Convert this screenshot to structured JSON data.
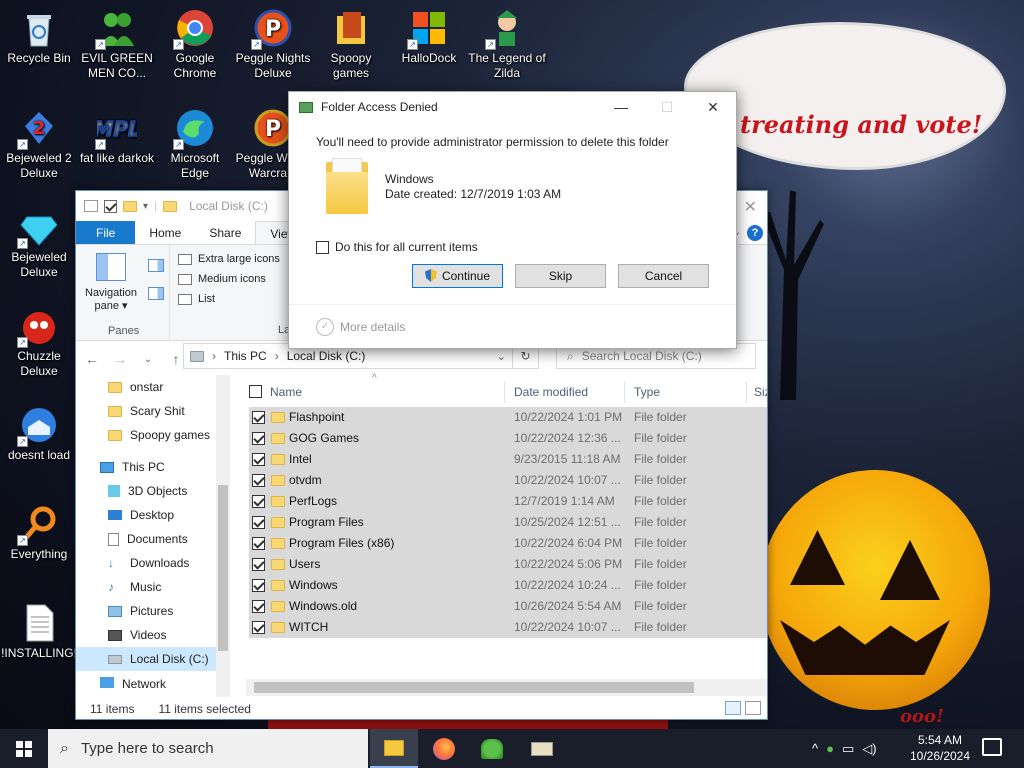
{
  "desktop": {
    "icons": [
      {
        "label": "Recycle Bin",
        "icon": "recycle-bin-icon"
      },
      {
        "label": "Bejeweled 2 Deluxe",
        "icon": "bejeweled2-icon"
      },
      {
        "label": "Bejeweled Deluxe",
        "icon": "bejeweled-icon"
      },
      {
        "label": "Chuzzle Deluxe",
        "icon": "chuzzle-icon"
      },
      {
        "label": "doesnt load",
        "icon": "thunderbird-icon"
      },
      {
        "label": "Everything",
        "icon": "everything-search-icon"
      },
      {
        "label": "!INSTALLING!",
        "icon": "text-file-icon"
      },
      {
        "label": "EVIL GREEN MEN CO...",
        "icon": "green-men-icon"
      },
      {
        "label": "fat like darkok",
        "icon": "mpl-icon"
      },
      {
        "label": "Google Chrome",
        "icon": "chrome-icon"
      },
      {
        "label": "Microsoft Edge",
        "icon": "edge-icon"
      },
      {
        "label": "Peggle Nights Deluxe",
        "icon": "peggle-nights-icon"
      },
      {
        "label": "Peggle W... of Warcra...",
        "icon": "peggle-wow-icon"
      },
      {
        "label": "Spoopy games",
        "icon": "folder-icon"
      },
      {
        "label": "HalloDock",
        "icon": "windows-logo-icon"
      },
      {
        "label": "The Legend of Zilda",
        "icon": "zilda-icon"
      }
    ],
    "wallpaper_text": {
      "line3": "treating and vote!",
      "signature": "ooo!"
    }
  },
  "explorer": {
    "title": "Local Disk (C:)",
    "tabs": [
      "File",
      "Home",
      "Share",
      "View"
    ],
    "ribbon": {
      "nav_pane_label": "Navigation pane",
      "panes_group": "Panes",
      "layout_group": "La",
      "layout_items": [
        "Extra large icons",
        "Medium icons",
        "List"
      ]
    },
    "address": {
      "segments": [
        "This PC",
        "Local Disk (C:)"
      ],
      "search_placeholder": "Search Local Disk (C:)"
    },
    "nav_items": [
      {
        "label": "onstar",
        "icon": "folder-icon"
      },
      {
        "label": "Scary Shit",
        "icon": "folder-icon"
      },
      {
        "label": "Spoopy games",
        "icon": "folder-icon"
      },
      {
        "label": "This PC",
        "icon": "computer-icon"
      },
      {
        "label": "3D Objects",
        "icon": "3d-objects-icon"
      },
      {
        "label": "Desktop",
        "icon": "desktop-icon"
      },
      {
        "label": "Documents",
        "icon": "documents-icon"
      },
      {
        "label": "Downloads",
        "icon": "downloads-icon"
      },
      {
        "label": "Music",
        "icon": "music-icon"
      },
      {
        "label": "Pictures",
        "icon": "pictures-icon"
      },
      {
        "label": "Videos",
        "icon": "videos-icon"
      },
      {
        "label": "Local Disk (C:)",
        "icon": "drive-icon",
        "selected": true
      },
      {
        "label": "Network",
        "icon": "network-icon"
      }
    ],
    "columns": [
      "Name",
      "Date modified",
      "Type",
      "Siz"
    ],
    "files": [
      {
        "name": "Flashpoint",
        "date": "10/22/2024 1:01 PM",
        "type": "File folder"
      },
      {
        "name": "GOG Games",
        "date": "10/22/2024 12:36 ...",
        "type": "File folder"
      },
      {
        "name": "Intel",
        "date": "9/23/2015 11:18 AM",
        "type": "File folder"
      },
      {
        "name": "otvdm",
        "date": "10/22/2024 10:07 ...",
        "type": "File folder"
      },
      {
        "name": "PerfLogs",
        "date": "12/7/2019 1:14 AM",
        "type": "File folder"
      },
      {
        "name": "Program Files",
        "date": "10/25/2024 12:51 ...",
        "type": "File folder"
      },
      {
        "name": "Program Files (x86)",
        "date": "10/22/2024 6:04 PM",
        "type": "File folder"
      },
      {
        "name": "Users",
        "date": "10/22/2024 5:06 PM",
        "type": "File folder"
      },
      {
        "name": "Windows",
        "date": "10/22/2024 10:24 ...",
        "type": "File folder"
      },
      {
        "name": "Windows.old",
        "date": "10/26/2024 5:54 AM",
        "type": "File folder"
      },
      {
        "name": "WITCH",
        "date": "10/22/2024 10:07 ...",
        "type": "File folder"
      }
    ],
    "status": {
      "count": "11 items",
      "selected": "11 items selected"
    }
  },
  "dialog": {
    "title": "Folder Access Denied",
    "message": "You'll need to provide administrator permission to delete this folder",
    "folder_name": "Windows",
    "folder_date": "Date created: 12/7/2019 1:03 AM",
    "checkbox_label": "Do this for all current items",
    "buttons": {
      "continue": "Continue",
      "skip": "Skip",
      "cancel": "Cancel"
    },
    "more_details": "More details"
  },
  "taskbar": {
    "search_placeholder": "Type here to search",
    "apps": [
      "file-explorer-icon",
      "firefox-icon",
      "green-men-icon",
      "app-icon"
    ],
    "clock": {
      "time": "5:54 AM",
      "date": "10/26/2024"
    }
  }
}
